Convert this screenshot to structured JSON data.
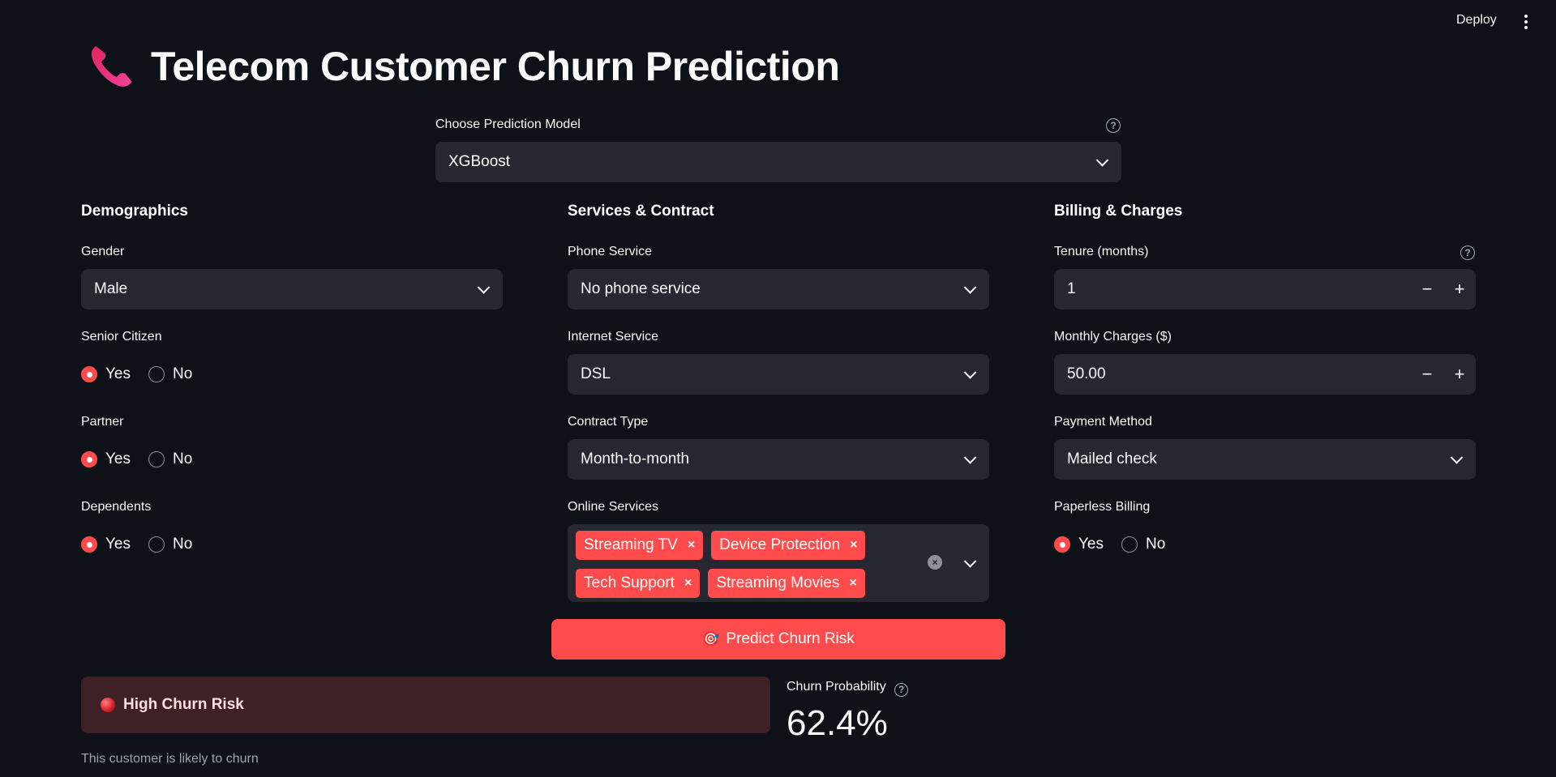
{
  "header": {
    "deploy_label": "Deploy",
    "menu_icon": "kebab-menu-icon"
  },
  "app": {
    "title": "Telecom Customer Churn Prediction",
    "title_icon": "telephone-receiver-icon"
  },
  "model": {
    "label": "Choose Prediction Model",
    "value": "XGBoost"
  },
  "demographics": {
    "heading": "Demographics",
    "gender": {
      "label": "Gender",
      "value": "Male"
    },
    "senior": {
      "label": "Senior Citizen",
      "yes": "Yes",
      "no": "No",
      "selected": "Yes"
    },
    "partner": {
      "label": "Partner",
      "yes": "Yes",
      "no": "No",
      "selected": "Yes"
    },
    "dependents": {
      "label": "Dependents",
      "yes": "Yes",
      "no": "No",
      "selected": "Yes"
    }
  },
  "services": {
    "heading": "Services & Contract",
    "phone": {
      "label": "Phone Service",
      "value": "No phone service"
    },
    "internet": {
      "label": "Internet Service",
      "value": "DSL"
    },
    "contract": {
      "label": "Contract Type",
      "value": "Month-to-month"
    },
    "online": {
      "label": "Online Services",
      "tags": [
        "Streaming TV",
        "Device Protection",
        "Tech Support",
        "Streaming Movies"
      ]
    }
  },
  "billing": {
    "heading": "Billing & Charges",
    "tenure": {
      "label": "Tenure (months)",
      "value": "1"
    },
    "monthly": {
      "label": "Monthly Charges ($)",
      "value": "50.00"
    },
    "payment": {
      "label": "Payment Method",
      "value": "Mailed check"
    },
    "paperless": {
      "label": "Paperless Billing",
      "yes": "Yes",
      "no": "No",
      "selected": "Yes"
    }
  },
  "action": {
    "predict_label": "Predict Churn Risk",
    "predict_icon": "dart-target-icon"
  },
  "result": {
    "alert_text": "High Churn Risk",
    "metric_label": "Churn Probability",
    "metric_value": "62.4%",
    "caption": "This customer is likely to churn"
  },
  "colors": {
    "accent": "#ff4b4b",
    "background": "#0e1117",
    "input_bg": "#262730",
    "alert_bg": "#3d2125"
  }
}
